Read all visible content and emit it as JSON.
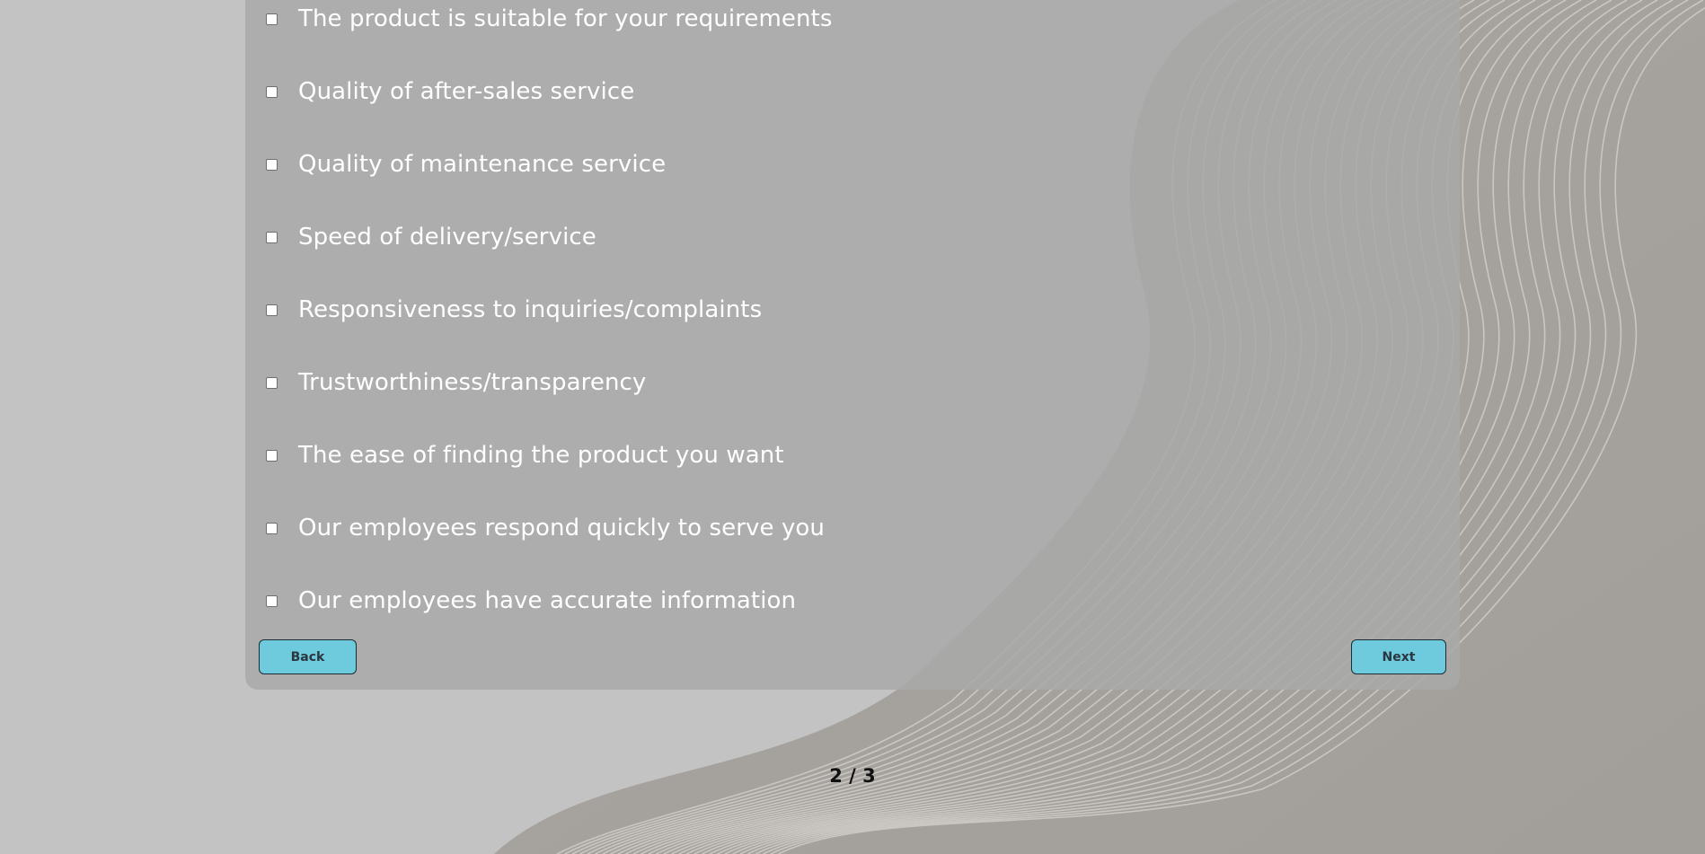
{
  "survey": {
    "options": [
      {
        "label": "The product is suitable for your requirements",
        "checked": false
      },
      {
        "label": "Quality of after-sales service",
        "checked": false
      },
      {
        "label": "Quality of maintenance service",
        "checked": false
      },
      {
        "label": "Speed of delivery/service",
        "checked": false
      },
      {
        "label": "Responsiveness to inquiries/complaints",
        "checked": false
      },
      {
        "label": "Trustworthiness/transparency",
        "checked": false
      },
      {
        "label": "The ease of finding the product you want",
        "checked": false
      },
      {
        "label": "Our employees respond quickly to serve you",
        "checked": false
      },
      {
        "label": "Our employees have accurate information",
        "checked": false
      }
    ]
  },
  "nav": {
    "back_label": "Back",
    "next_label": "Next"
  },
  "pagination": {
    "text": "2 / 3"
  },
  "colors": {
    "page_background": "#c3c3c3",
    "button_fill": "#6dcbdd",
    "option_text": "#ffffff"
  }
}
